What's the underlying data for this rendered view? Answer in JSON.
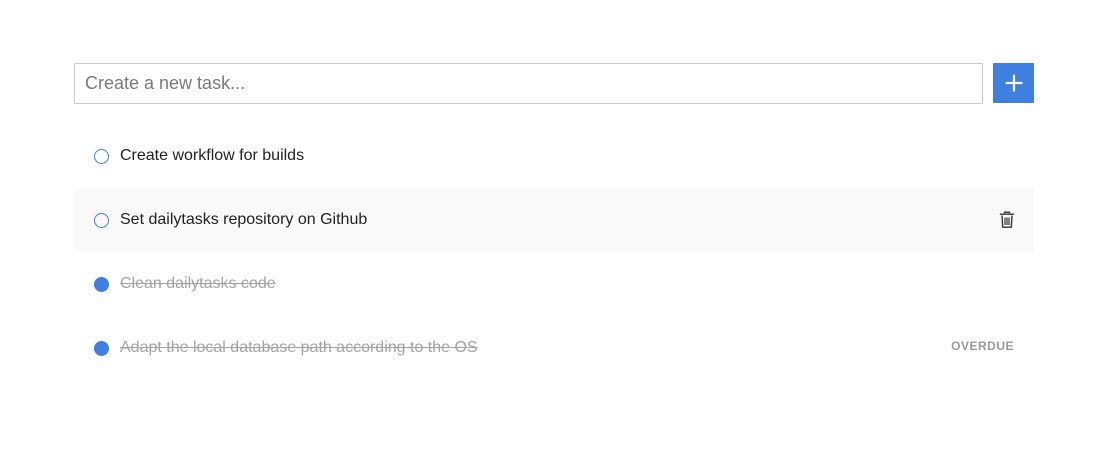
{
  "new_task": {
    "placeholder": "Create a new task...",
    "add_button_icon": "plus-icon"
  },
  "accent_color": "#3f7fe0",
  "tasks": [
    {
      "label": "Create workflow for builds",
      "done": false
    },
    {
      "label": "Set dailytasks repository on Github",
      "done": false,
      "delete_icon": "trash-icon"
    },
    {
      "label": "Clean dailytasks code",
      "done": true
    },
    {
      "label": "Adapt the local database path according to the OS",
      "done": true,
      "badge": "OVERDUE"
    }
  ]
}
